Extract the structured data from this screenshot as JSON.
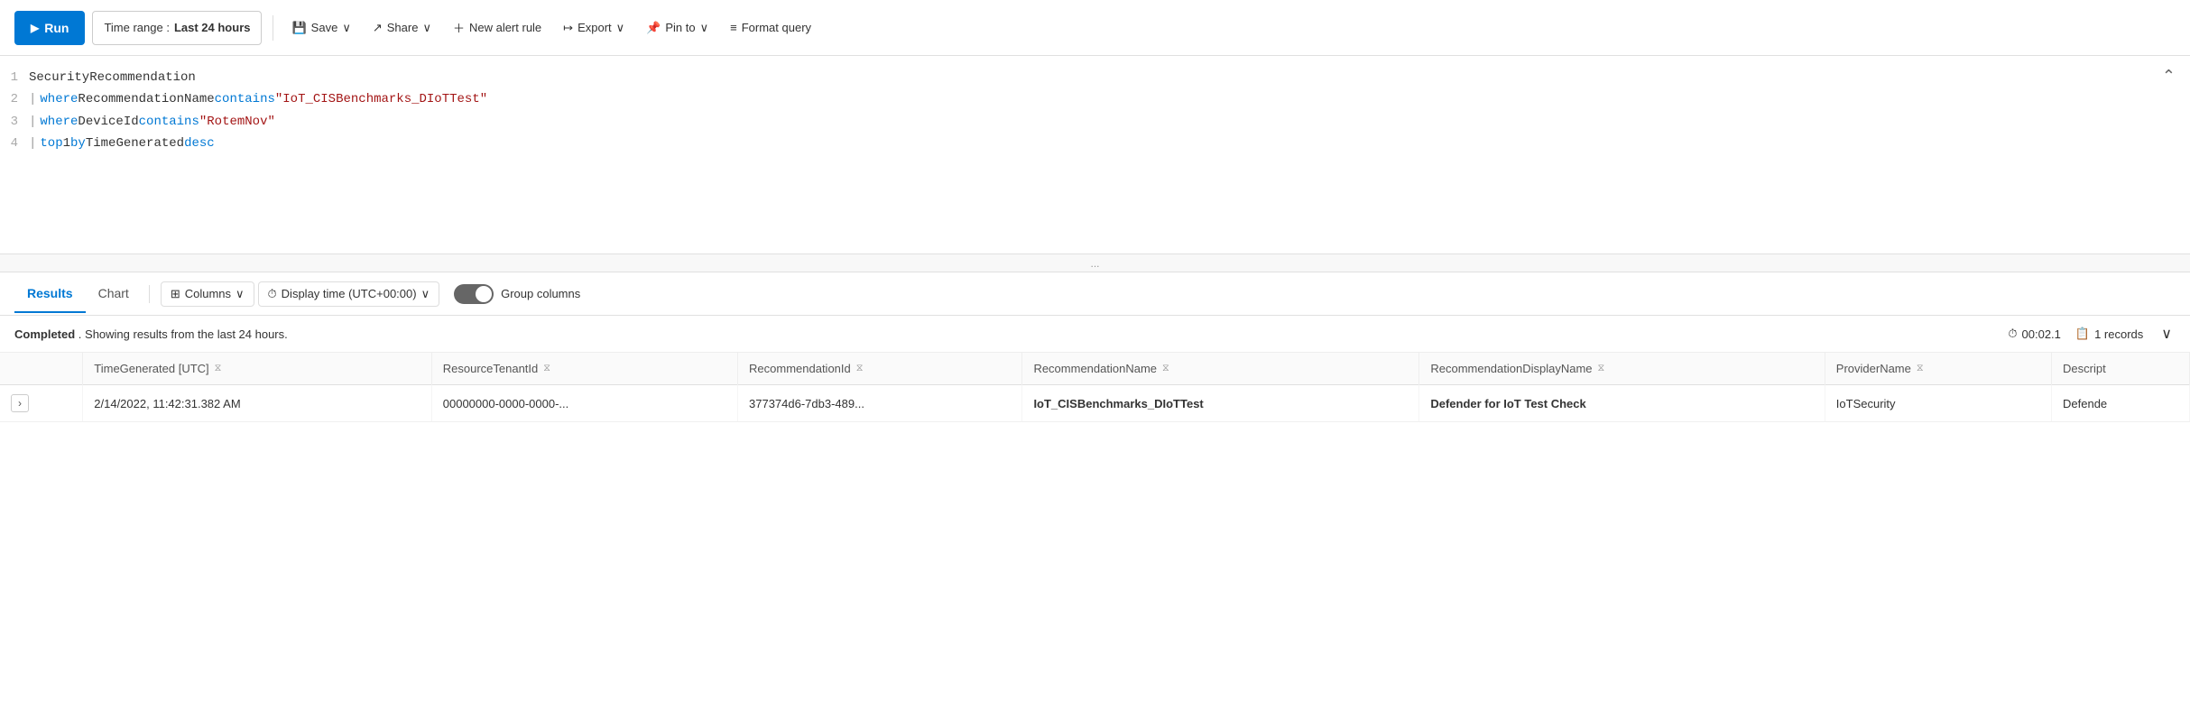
{
  "toolbar": {
    "run_label": "Run",
    "time_range_label": "Time range : ",
    "time_range_value": "Last 24 hours",
    "save_label": "Save",
    "share_label": "Share",
    "new_alert_label": "New alert rule",
    "export_label": "Export",
    "pin_to_label": "Pin to",
    "format_query_label": "Format query"
  },
  "query": {
    "lines": [
      {
        "num": "1",
        "content": "SecurityRecommendation"
      },
      {
        "num": "2",
        "pipe": "| ",
        "kw1": "where ",
        "plain1": "RecommendationName ",
        "func": "contains ",
        "str": "\"IoT_CISBenchmarks_DIoTTest\""
      },
      {
        "num": "3",
        "pipe": "| ",
        "kw1": "where ",
        "plain1": "DeviceId ",
        "func": "contains ",
        "str": "\"RotemNov\""
      },
      {
        "num": "4",
        "pipe": "| ",
        "kw1": "top ",
        "plain1": "1 ",
        "kw2": "by ",
        "plain2": "TimeGenerated ",
        "kw3": "desc"
      }
    ]
  },
  "drag_handle": "...",
  "results": {
    "tabs": [
      {
        "id": "results",
        "label": "Results"
      },
      {
        "id": "chart",
        "label": "Chart"
      }
    ],
    "active_tab": "results",
    "columns_label": "Columns",
    "display_time_label": "Display time (UTC+00:00)",
    "group_columns_label": "Group columns",
    "status": {
      "completed_label": "Completed",
      "message": ". Showing results from the last 24 hours.",
      "time": "00:02.1",
      "records": "1 records"
    },
    "table": {
      "headers": [
        "TimeGenerated [UTC]",
        "ResourceTenantId",
        "RecommendationId",
        "RecommendationName",
        "RecommendationDisplayName",
        "ProviderName",
        "Descript"
      ],
      "rows": [
        {
          "time": "2/14/2022, 11:42:31.382 AM",
          "tenant": "00000000-0000-0000-...",
          "rec_id": "377374d6-7db3-489...",
          "rec_name": "IoT_CISBenchmarks_DIoTTest",
          "display_name": "Defender for IoT Test Check",
          "provider": "IoTSecurity",
          "desc": "Defende"
        }
      ]
    }
  }
}
